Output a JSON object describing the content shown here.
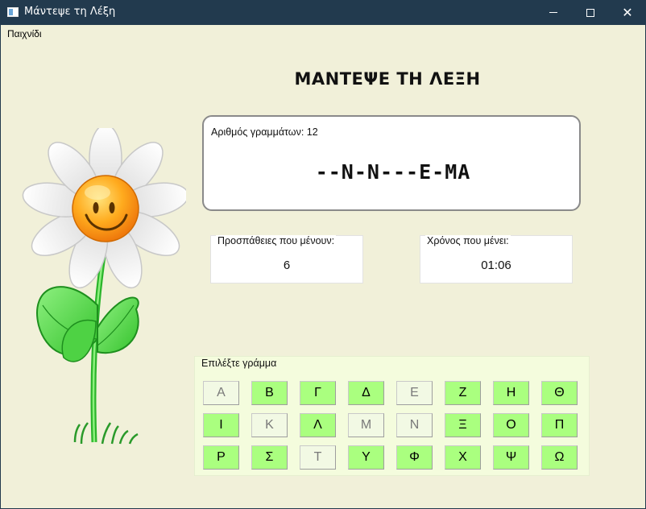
{
  "window": {
    "title": "Μάντεψε τη Λέξη"
  },
  "menubar": {
    "items": [
      {
        "label": "Παιχνίδι"
      }
    ]
  },
  "game": {
    "title": "ΜΑΝΤΕΨΕ ΤΗ ΛΕΞΗ",
    "letters_count_label": "Αριθμός γραμμάτων: 12",
    "masked_word": "--N-N---E-MA",
    "attempts_label": "Προσπάθειες που μένουν:",
    "attempts_value": "6",
    "time_label": "Χρόνος που μένει:",
    "time_value": "01:06"
  },
  "letters_panel": {
    "legend": "Επιλέξτε γράμμα",
    "letters": [
      {
        "char": "Α",
        "state": "used"
      },
      {
        "char": "Β",
        "state": "active"
      },
      {
        "char": "Γ",
        "state": "active"
      },
      {
        "char": "Δ",
        "state": "active"
      },
      {
        "char": "Ε",
        "state": "used"
      },
      {
        "char": "Ζ",
        "state": "active"
      },
      {
        "char": "Η",
        "state": "active"
      },
      {
        "char": "Θ",
        "state": "active"
      },
      {
        "char": "Ι",
        "state": "active"
      },
      {
        "char": "Κ",
        "state": "used"
      },
      {
        "char": "Λ",
        "state": "active"
      },
      {
        "char": "Μ",
        "state": "used"
      },
      {
        "char": "Ν",
        "state": "used"
      },
      {
        "char": "Ξ",
        "state": "active"
      },
      {
        "char": "Ο",
        "state": "active"
      },
      {
        "char": "Π",
        "state": "active"
      },
      {
        "char": "Ρ",
        "state": "active"
      },
      {
        "char": "Σ",
        "state": "active"
      },
      {
        "char": "Τ",
        "state": "used"
      },
      {
        "char": "Υ",
        "state": "active"
      },
      {
        "char": "Φ",
        "state": "active"
      },
      {
        "char": "Χ",
        "state": "active"
      },
      {
        "char": "Ψ",
        "state": "active"
      },
      {
        "char": "Ω",
        "state": "active"
      }
    ]
  },
  "colors": {
    "background": "#f1f0d9",
    "titlebar": "#223a4e",
    "letter_active": "#aaff7f",
    "letter_used": "#f2f9e4",
    "panel": "#f4fcdd"
  },
  "icons": {
    "app": "window-app-icon",
    "minimize": "minimize-icon",
    "maximize": "maximize-icon",
    "close": "close-icon",
    "illustration": "smiling-daisy"
  }
}
